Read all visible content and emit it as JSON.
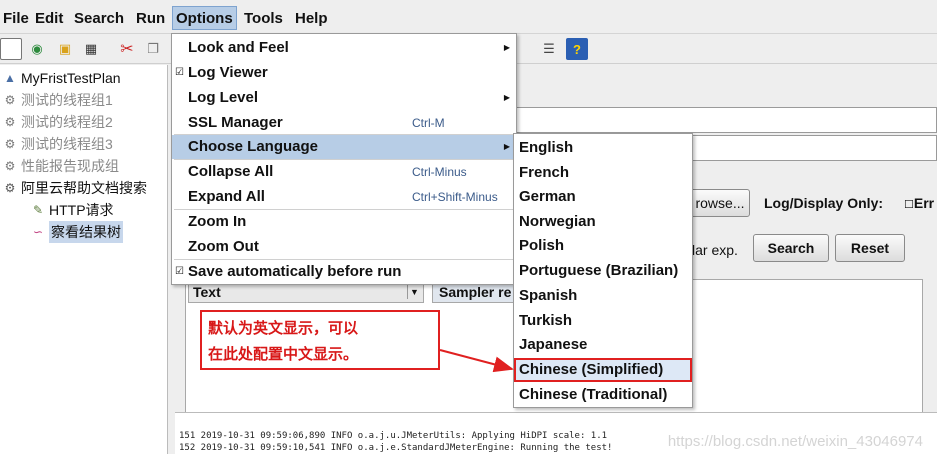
{
  "menubar": {
    "items": [
      {
        "label": "File",
        "key": "F"
      },
      {
        "label": "Edit",
        "key": "E"
      },
      {
        "label": "Search",
        "key": "S"
      },
      {
        "label": "Run",
        "key": "R"
      },
      {
        "label": "Options",
        "key": "O"
      },
      {
        "label": "Tools",
        "key": "T"
      },
      {
        "label": "Help",
        "key": "H"
      }
    ]
  },
  "toolbar": {
    "icons": [
      "new-icon",
      "templates-icon",
      "open-icon",
      "save-icon",
      "cut-icon",
      "copy-icon"
    ],
    "right_icons": [
      "function-helper-icon",
      "help-icon"
    ]
  },
  "tree": {
    "items": [
      {
        "label": "MyFristTestPlan",
        "icon": "test-plan-icon",
        "disabled": false
      },
      {
        "label": "测试的线程组1",
        "icon": "thread-group-icon",
        "disabled": true
      },
      {
        "label": "测试的线程组2",
        "icon": "thread-group-icon",
        "disabled": true
      },
      {
        "label": "测试的线程组3",
        "icon": "thread-group-icon",
        "disabled": true
      },
      {
        "label": "性能报告现成组",
        "icon": "thread-group-icon",
        "disabled": true
      },
      {
        "label": "阿里云帮助文档搜索",
        "icon": "thread-group-icon",
        "disabled": false
      },
      {
        "label": "HTTP请求",
        "icon": "sampler-icon",
        "disabled": false
      },
      {
        "label": "察看结果树",
        "icon": "listener-icon",
        "disabled": false
      }
    ]
  },
  "options_menu": {
    "items": [
      {
        "label": "Look and Feel",
        "accel": "",
        "submenu": true,
        "checked": false
      },
      {
        "label": "Log Viewer",
        "accel": "",
        "submenu": false,
        "checked": true
      },
      {
        "label": "Log Level",
        "accel": "",
        "submenu": true,
        "checked": false
      },
      {
        "label": "SSL Manager",
        "accel": "Ctrl-M",
        "submenu": false,
        "checked": false
      },
      {
        "label": "Choose Language",
        "accel": "",
        "submenu": true,
        "checked": false,
        "highlighted": true
      },
      {
        "label": "Collapse All",
        "accel": "Ctrl-Minus",
        "submenu": false,
        "checked": false
      },
      {
        "label": "Expand All",
        "accel": "Ctrl+Shift-Minus",
        "submenu": false,
        "checked": false
      },
      {
        "label": "Zoom In",
        "accel": "",
        "submenu": false,
        "checked": false
      },
      {
        "label": "Zoom Out",
        "accel": "",
        "submenu": false,
        "checked": false
      },
      {
        "label": "Save automatically before run",
        "accel": "",
        "submenu": false,
        "checked": true
      }
    ]
  },
  "language_menu": {
    "items": [
      "English",
      "French",
      "German",
      "Norwegian",
      "Polish",
      "Portuguese (Brazilian)",
      "Spanish",
      "Turkish",
      "Japanese",
      "Chinese (Simplified)",
      "Chinese (Traditional)"
    ],
    "boxed": "Chinese (Simplified)"
  },
  "right_panel": {
    "browse_label": "rowse...",
    "log_display_label": "Log/Display Only:",
    "errors_label": "Err",
    "regex_label": "lar exp.",
    "search_button": "Search",
    "reset_button": "Reset",
    "results_column": "Text",
    "tab_label": "Sampler re"
  },
  "annotation": {
    "line1": "默认为英文显示，可以",
    "line2": "在此处配置中文显示。"
  },
  "log": {
    "lines": [
      "151 2019-10-31 09:59:06,890 INFO o.a.j.u.JMeterUtils: Applying HiDPI scale: 1.1",
      "152 2019-10-31 09:59:10,541 INFO o.a.j.e.StandardJMeterEngine: Running the test!"
    ],
    "watermark": "https://blog.csdn.net/weixin_43046974"
  },
  "colors": {
    "menu_highlight": "#b7cde6",
    "annotation_red": "#e02020"
  }
}
